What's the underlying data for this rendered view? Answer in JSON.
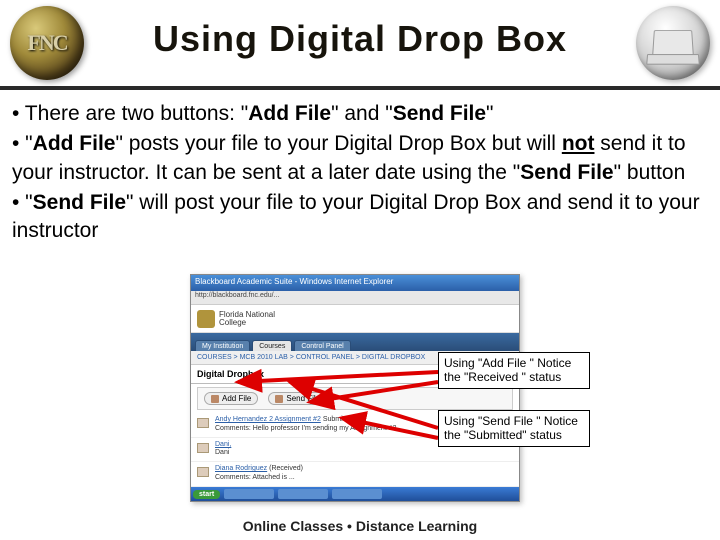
{
  "header": {
    "logo_text": "FNC",
    "title": "Using Digital Drop Box"
  },
  "bullets": {
    "b1_pre": "• There are two buttons: \"",
    "b1_bold1": "Add File",
    "b1_mid": "\" and \"",
    "b1_bold2": "Send File",
    "b1_post": "\"",
    "b2_pre": "• \"",
    "b2_bold": "Add File",
    "b2_mid": "\" posts your file to your Digital Drop Box but will ",
    "b2_not": "not",
    "b2_rest": " send it to your instructor.  It can be sent at a later date using the \"",
    "b2_bold2": "Send File",
    "b2_post": "\" button",
    "b3_pre": "• \"",
    "b3_bold": "Send File",
    "b3_rest": "\" will post your file to your Digital Drop Box and send it to your instructor"
  },
  "screenshot": {
    "win_title": "Blackboard Academic Suite - Windows Internet Explorer",
    "toolbar": "http://blackboard.fnc.edu/...",
    "brand_line1": "Florida National",
    "brand_line2": "College",
    "tabs": [
      "My Institution",
      "Courses",
      "Control Panel"
    ],
    "breadcrumb": "COURSES > MCB 2010 LAB > CONTROL PANEL > DIGITAL DROPBOX",
    "panel_title": "Digital Dropbox",
    "btn_add": "Add File",
    "btn_send": "Send File",
    "entry1_name": "Andy Hernandez 2   Assignment #2",
    "entry1_meta": "Submitted",
    "entry1_comment": "Comments: Hello professor I'm sending my Assignment #2",
    "entry2_name": "Dani,",
    "entry2_meta": "Dani",
    "entry3_name": "Diana Rodriguez",
    "entry3_meta": "(Received)",
    "entry3_comment": "Comments: Attached is ...",
    "taskbar_start": "start"
  },
  "callouts": {
    "add": "Using \"Add File \" Notice the \"Received \" status",
    "send": "Using \"Send  File \" Notice the \"Submitted\" status"
  },
  "footer": "Online Classes  •  Distance Learning"
}
